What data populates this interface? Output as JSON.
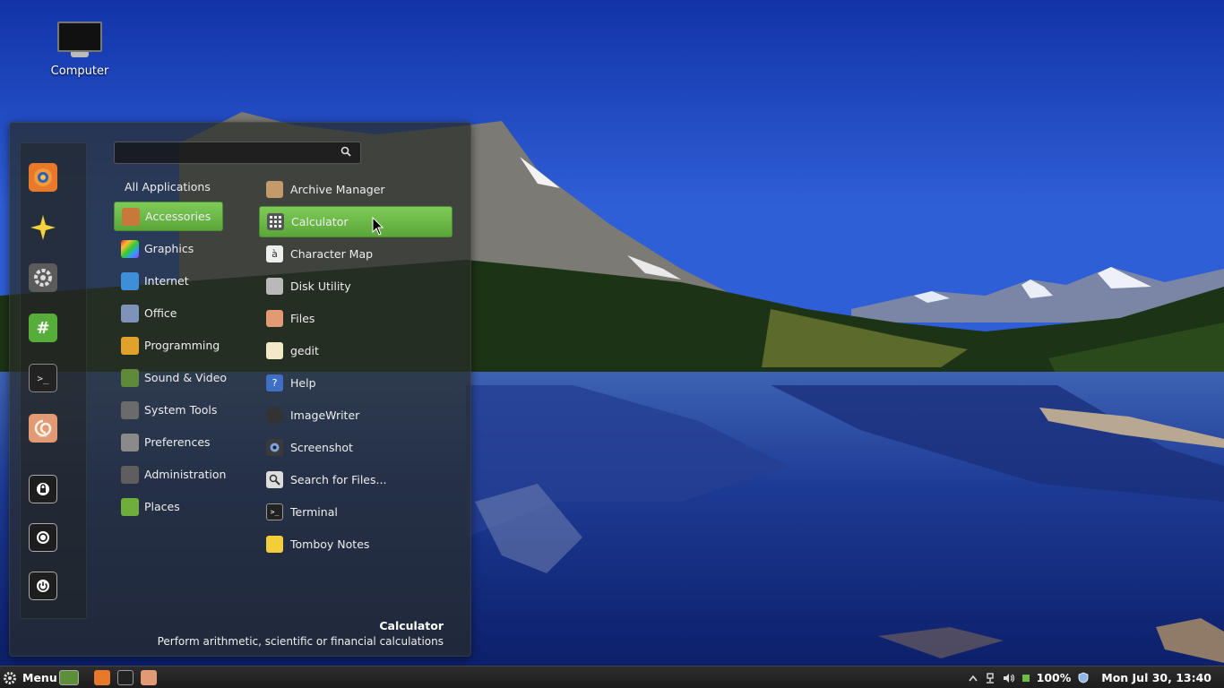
{
  "desktop": {
    "icons": [
      {
        "label": "Computer",
        "icon": "computer-icon"
      }
    ]
  },
  "menu": {
    "search": {
      "value": "",
      "placeholder": ""
    },
    "favorites": [
      {
        "name": "firefox-icon",
        "color": "#e8782a"
      },
      {
        "name": "star-icon",
        "color": "#f5d13a"
      },
      {
        "name": "settings-icon",
        "color": "#6b6b6b"
      },
      {
        "name": "hexchat-icon",
        "color": "#57ad3a"
      },
      {
        "name": "terminal-icon",
        "color": "#2b2b2b"
      },
      {
        "name": "files-icon",
        "color": "#e29a74"
      },
      {
        "name": "lock-icon",
        "color": "#2b2b2b"
      },
      {
        "name": "logout-icon",
        "color": "#2b2b2b"
      },
      {
        "name": "power-icon",
        "color": "#2b2b2b"
      }
    ],
    "categories": [
      {
        "label": "All Applications"
      },
      {
        "label": "Accessories",
        "active": true
      },
      {
        "label": "Graphics"
      },
      {
        "label": "Internet"
      },
      {
        "label": "Office"
      },
      {
        "label": "Programming"
      },
      {
        "label": "Sound & Video"
      },
      {
        "label": "System Tools"
      },
      {
        "label": "Preferences"
      },
      {
        "label": "Administration"
      },
      {
        "label": "Places"
      }
    ],
    "apps": [
      {
        "label": "Archive Manager"
      },
      {
        "label": "Calculator",
        "active": true
      },
      {
        "label": "Character Map"
      },
      {
        "label": "Disk Utility"
      },
      {
        "label": "Files"
      },
      {
        "label": "gedit"
      },
      {
        "label": "Help"
      },
      {
        "label": "ImageWriter"
      },
      {
        "label": "Screenshot"
      },
      {
        "label": "Search for Files..."
      },
      {
        "label": "Terminal"
      },
      {
        "label": "Tomboy Notes"
      }
    ],
    "description": {
      "title": "Calculator",
      "text": "Perform arithmetic, scientific or financial calculations"
    }
  },
  "taskbar": {
    "menu_label": "Menu",
    "launchers": [
      "show-desktop-icon",
      "firefox-icon",
      "terminal-icon",
      "files-icon"
    ],
    "battery": "100%",
    "clock": "Mon Jul 30, 13:40"
  },
  "colors": {
    "accent": "#6cbb47",
    "panel": "#1f1f1f"
  }
}
